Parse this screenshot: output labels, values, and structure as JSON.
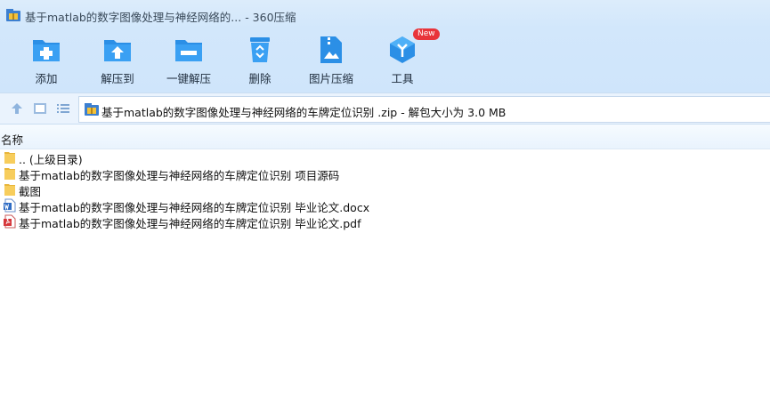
{
  "window": {
    "title": "基于matlab的数字图像处理与神经网络的... - 360压缩"
  },
  "toolbar": {
    "items": [
      {
        "label": "添加",
        "icon": "folder-add-icon"
      },
      {
        "label": "解压到",
        "icon": "folder-extract-icon"
      },
      {
        "label": "一键解压",
        "icon": "one-click-extract-icon"
      },
      {
        "label": "删除",
        "icon": "recycle-bin-icon"
      },
      {
        "label": "图片压缩",
        "icon": "image-compress-icon"
      },
      {
        "label": "工具",
        "icon": "tools-cube-icon",
        "badge": "New"
      }
    ]
  },
  "address": {
    "path": "基于matlab的数字图像处理与神经网络的车牌定位识别 .zip - 解包大小为 3.0 MB"
  },
  "list": {
    "column_name": "名称",
    "rows": [
      {
        "name": ".. (上级目录)",
        "type": "folder"
      },
      {
        "name": "基于matlab的数字图像处理与神经网络的车牌定位识别 项目源码",
        "type": "folder"
      },
      {
        "name": "截图",
        "type": "folder"
      },
      {
        "name": "基于matlab的数字图像处理与神经网络的车牌定位识别 毕业论文.docx",
        "type": "docx"
      },
      {
        "name": "基于matlab的数字图像处理与神经网络的车牌定位识别 毕业论文.pdf",
        "type": "pdf"
      }
    ]
  },
  "colors": {
    "accent": "#2b8fe6",
    "badge": "#e8343a",
    "folder": "#f5c242"
  }
}
